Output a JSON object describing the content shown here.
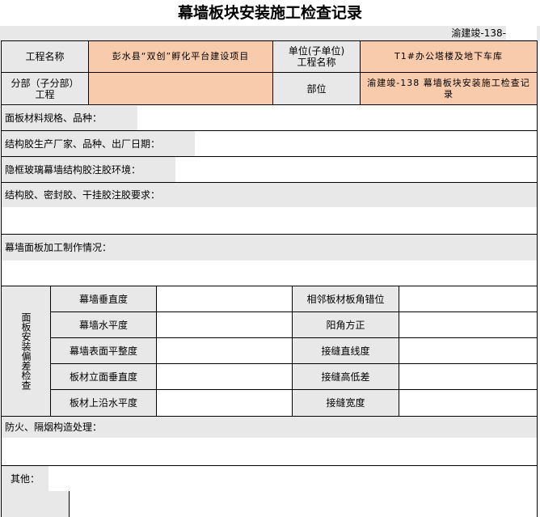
{
  "title": "幕墙板块安装施工检查记录",
  "doc_no": "渝建竣-138-",
  "header": {
    "project_label": "工程名称",
    "project_value": "彭水县“双创”孵化平台建设项目",
    "unit_label": "单位(子单位)\n工程名称",
    "unit_value": "T1#办公塔楼及地下车库",
    "subdiv_label": "分部（子分部）\n工程",
    "part_label": "部位",
    "part_value": "渝建竣-138 幕墙板块安装施工检查记录"
  },
  "rows": {
    "panel_material": "面板材料规格、品种：",
    "adhesive_maker": "结构胶生产厂家、品种、出厂日期：",
    "glass_env": "隐框玻璃幕墙结构胶注胶环境：",
    "adhesive_req": "结构胶、密封胶、干挂胶注胶要求：",
    "panel_fab": "幕墙面板加工制作情况：",
    "fire": "防火、隔烟构造处理：",
    "other": "其他："
  },
  "deviation": {
    "group_label": "面板安装偏差检查",
    "left_items": [
      "幕墙垂直度",
      "幕墙水平度",
      "幕墙表面平整度",
      "板材立面垂直度",
      "板材上沿水平度"
    ],
    "right_items": [
      "相邻板材板角错位",
      "阳角方正",
      "接缝直线度",
      "接缝高低差",
      "接缝宽度"
    ]
  }
}
